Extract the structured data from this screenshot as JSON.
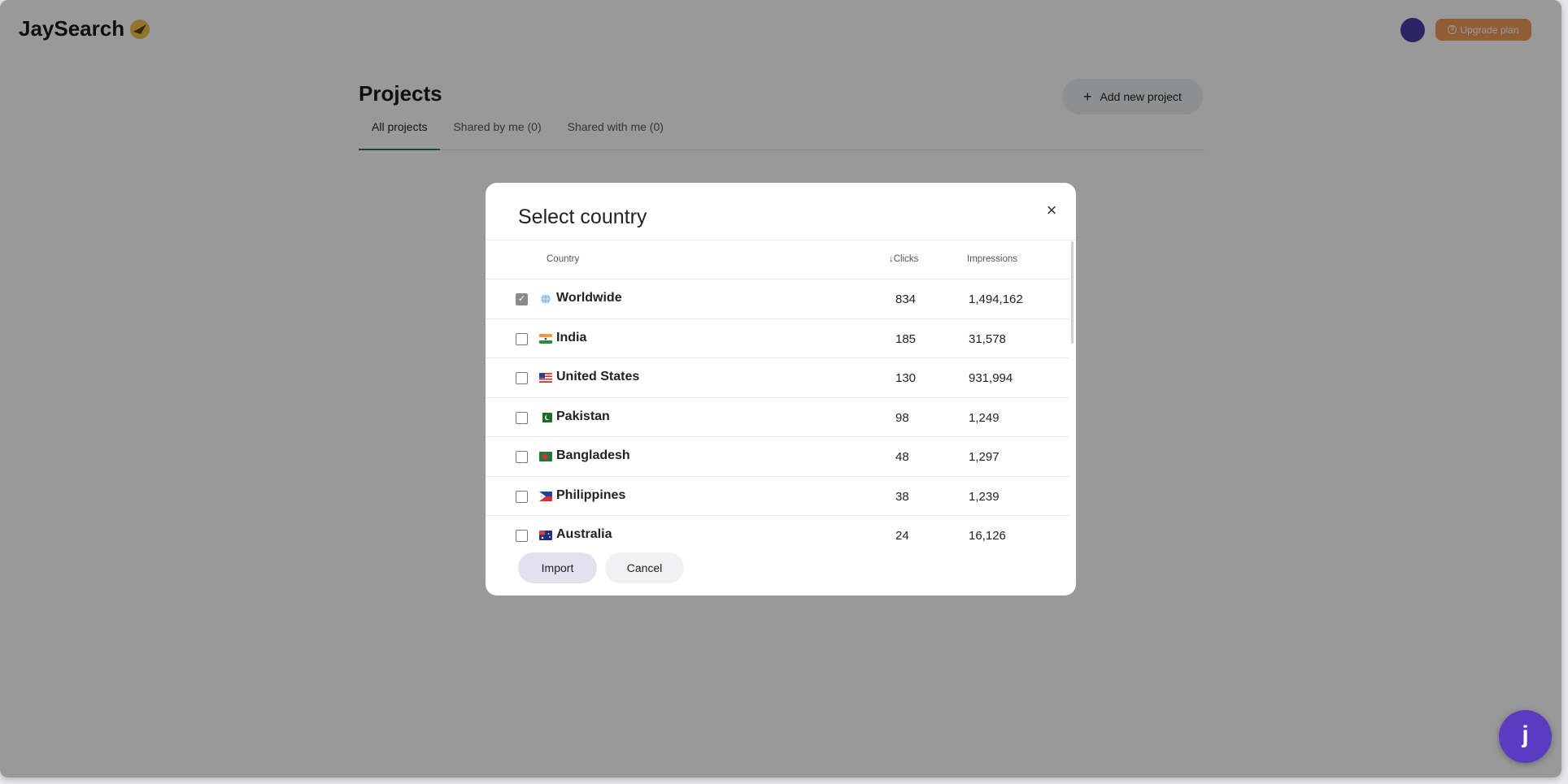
{
  "app": {
    "logo_text": "JaySearch",
    "upgrade_label": "Upgrade plan",
    "upgrade_icon": "$"
  },
  "page": {
    "title": "Projects",
    "add_project_label": "Add new project",
    "tabs": [
      {
        "label": "All projects",
        "active": true
      },
      {
        "label": "Shared by me (0)"
      },
      {
        "label": "Shared with me (0)"
      }
    ]
  },
  "modal": {
    "title": "Select country",
    "close_icon": "×",
    "columns": {
      "country": "Country",
      "clicks": "Clicks",
      "impressions": "Impressions",
      "sort_icon": "↓"
    },
    "rows": [
      {
        "country": "Worldwide",
        "clicks": "834",
        "impressions": "1,494,162",
        "checked": true,
        "flag": "globe"
      },
      {
        "country": "India",
        "clicks": "185",
        "impressions": "31,578",
        "checked": false,
        "flag": "india"
      },
      {
        "country": "United States",
        "clicks": "130",
        "impressions": "931,994",
        "checked": false,
        "flag": "usa"
      },
      {
        "country": "Pakistan",
        "clicks": "98",
        "impressions": "1,249",
        "checked": false,
        "flag": "pakistan"
      },
      {
        "country": "Bangladesh",
        "clicks": "48",
        "impressions": "1,297",
        "checked": false,
        "flag": "bangladesh"
      },
      {
        "country": "Philippines",
        "clicks": "38",
        "impressions": "1,239",
        "checked": false,
        "flag": "philippines"
      },
      {
        "country": "Australia",
        "clicks": "24",
        "impressions": "16,126",
        "checked": false,
        "flag": "australia"
      }
    ],
    "import_label": "Import",
    "cancel_label": "Cancel"
  },
  "chat": {
    "icon_glyph": "j"
  },
  "colors": {
    "accent": "#5b3bc0",
    "upgrade": "#f39a5c",
    "tab_active": "#2f7d3a"
  }
}
